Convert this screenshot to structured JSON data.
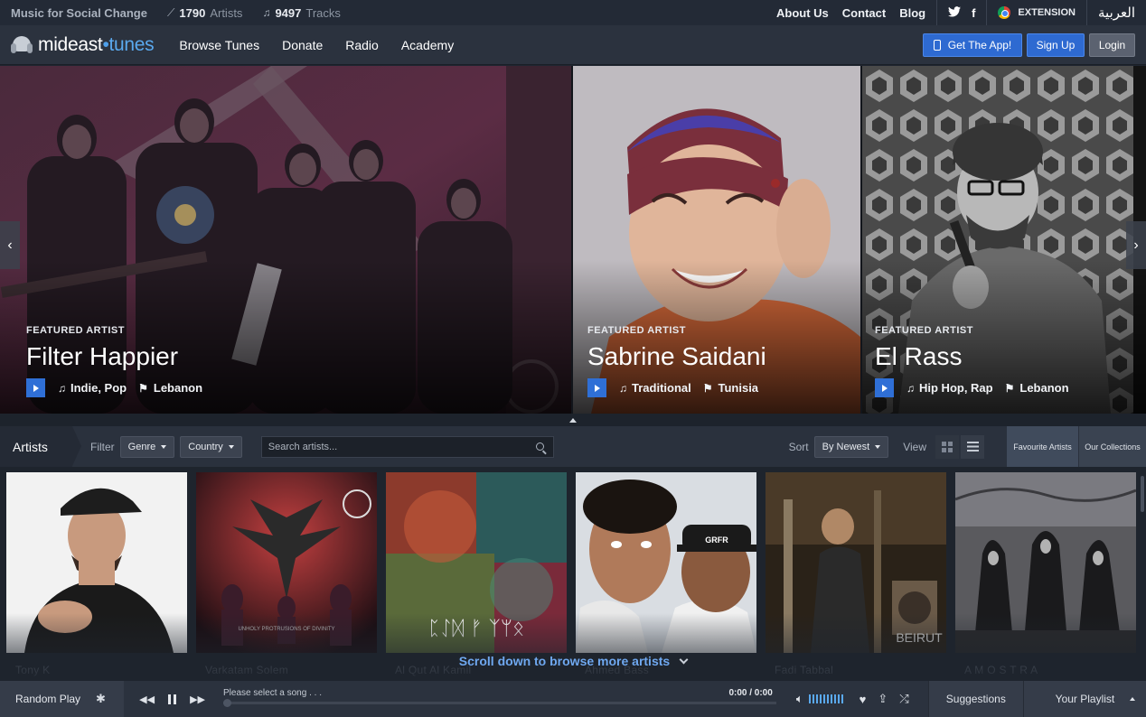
{
  "topbar": {
    "tagline": "Music for Social Change",
    "artists_count": "1790",
    "artists_label": "Artists",
    "tracks_count": "9497",
    "tracks_label": "Tracks",
    "links": [
      "About Us",
      "Contact",
      "Blog"
    ],
    "social": {
      "twitter": "𝕥",
      "facebook": "f"
    },
    "extension": "EXTENSION",
    "arabic": "العربية"
  },
  "nav": {
    "logo_main": "mideast",
    "logo_dot": "•",
    "logo_tail": "tunes",
    "links": [
      "Browse Tunes",
      "Donate",
      "Radio",
      "Academy"
    ],
    "get_app": "Get The App!",
    "sign_up": "Sign Up",
    "login": "Login"
  },
  "featured": [
    {
      "label": "FEATURED ARTIST",
      "name": "Filter Happier",
      "genre": "Indie, Pop",
      "country": "Lebanon"
    },
    {
      "label": "FEATURED ARTIST",
      "name": "Sabrine Saidani",
      "genre": "Traditional",
      "country": "Tunisia"
    },
    {
      "label": "FEATURED ARTIST",
      "name": "El Rass",
      "genre": "Hip Hop, Rap",
      "country": "Lebanon"
    }
  ],
  "artists_bar": {
    "title": "Artists",
    "filter_label": "Filter",
    "genre": "Genre",
    "country": "Country",
    "search_placeholder": "Search artists...",
    "sort_label": "Sort",
    "sort_value": "By Newest",
    "view_label": "View",
    "tab_favourites": "Favourite Artists",
    "tab_collections": "Our Collections"
  },
  "artists": [
    {
      "name": "Tony K"
    },
    {
      "name": "Varkatam Solem",
      "art_text": "UNHOLY PROTRUSIONS OF DIVINITY"
    },
    {
      "name": "Al Qut Al Kamil",
      "art_text": "ᛈᛇᛞ ᚠ ᛉᛘᛟ"
    },
    {
      "name": "Ahmed Bass"
    },
    {
      "name": "Fadi Tabbal",
      "art_text": "BEIRUT"
    },
    {
      "name": "A M O S T R A"
    }
  ],
  "scroll_hint": "Scroll down to browse more artists",
  "player": {
    "random": "Random Play",
    "song": "Please select a song . . .",
    "time": "0:00 / 0:00",
    "suggestions": "Suggestions",
    "playlist": "Your Playlist"
  },
  "colors": {
    "accent": "#2e6ad1",
    "link": "#6fa8f0"
  }
}
